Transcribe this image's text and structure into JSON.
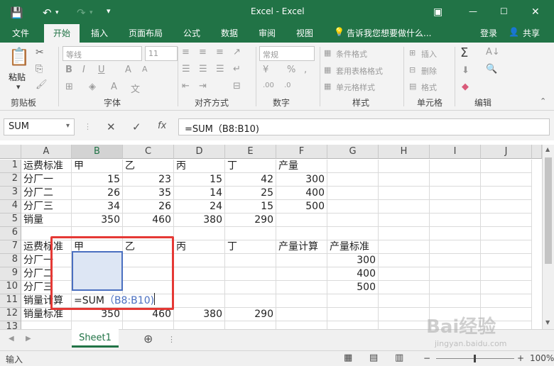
{
  "window": {
    "title": "Excel - Excel",
    "share_label": "共享",
    "login_label": "登录"
  },
  "ribbon_tabs": [
    "文件",
    "开始",
    "插入",
    "页面布局",
    "公式",
    "数据",
    "审阅",
    "视图"
  ],
  "tell_me": "告诉我您想要做什么...",
  "ribbon": {
    "paste": "粘贴",
    "font_name": "等线",
    "font_size": "11",
    "number_format": "常规",
    "conditional_format": "条件格式",
    "table_format": "套用表格格式",
    "cell_style": "单元格样式",
    "insert": "插入",
    "delete": "删除",
    "format": "格式",
    "groups": [
      "剪贴板",
      "字体",
      "对齐方式",
      "数字",
      "样式",
      "单元格",
      "编辑"
    ]
  },
  "formula_bar": {
    "name_box": "SUM",
    "formula": "=SUM（B8:B10)",
    "fx": "fx"
  },
  "columns": [
    "A",
    "B",
    "C",
    "D",
    "E",
    "F",
    "G",
    "H",
    "I",
    "J"
  ],
  "rows": [
    [
      "运费标准",
      "甲",
      "乙",
      "丙",
      "丁",
      "产量",
      "",
      "",
      "",
      ""
    ],
    [
      "分厂一",
      "15",
      "23",
      "15",
      "42",
      "300",
      "",
      "",
      "",
      ""
    ],
    [
      "分厂二",
      "26",
      "35",
      "14",
      "25",
      "400",
      "",
      "",
      "",
      ""
    ],
    [
      "分厂三",
      "34",
      "26",
      "24",
      "15",
      "500",
      "",
      "",
      "",
      ""
    ],
    [
      "销量",
      "350",
      "460",
      "380",
      "290",
      "",
      "",
      "",
      "",
      ""
    ],
    [
      "",
      "",
      "",
      "",
      "",
      "",
      "",
      "",
      "",
      ""
    ],
    [
      "运费标准",
      "甲",
      "乙",
      "丙",
      "丁",
      "产量计算",
      "产量标准",
      "",
      "",
      ""
    ],
    [
      "分厂一",
      "",
      "",
      "",
      "",
      "",
      "300",
      "",
      "",
      ""
    ],
    [
      "分厂二",
      "",
      "",
      "",
      "",
      "",
      "400",
      "",
      "",
      ""
    ],
    [
      "分厂三",
      "",
      "",
      "",
      "",
      "",
      "500",
      "",
      "",
      ""
    ],
    [
      "销量计算",
      "=SUM（B8:B10)",
      "",
      "",
      "",
      "",
      "",
      "",
      "",
      ""
    ],
    [
      "销量标准",
      "350",
      "460",
      "380",
      "290",
      "",
      "",
      "",
      "",
      ""
    ],
    [
      "",
      "",
      "",
      "",
      "",
      "",
      "",
      "",
      "",
      ""
    ]
  ],
  "sheet_tab": "Sheet1",
  "status": {
    "mode": "输入",
    "zoom": "100%"
  },
  "watermark": {
    "main": "Bai经验",
    "sub": "jingyan.baidu.com"
  }
}
